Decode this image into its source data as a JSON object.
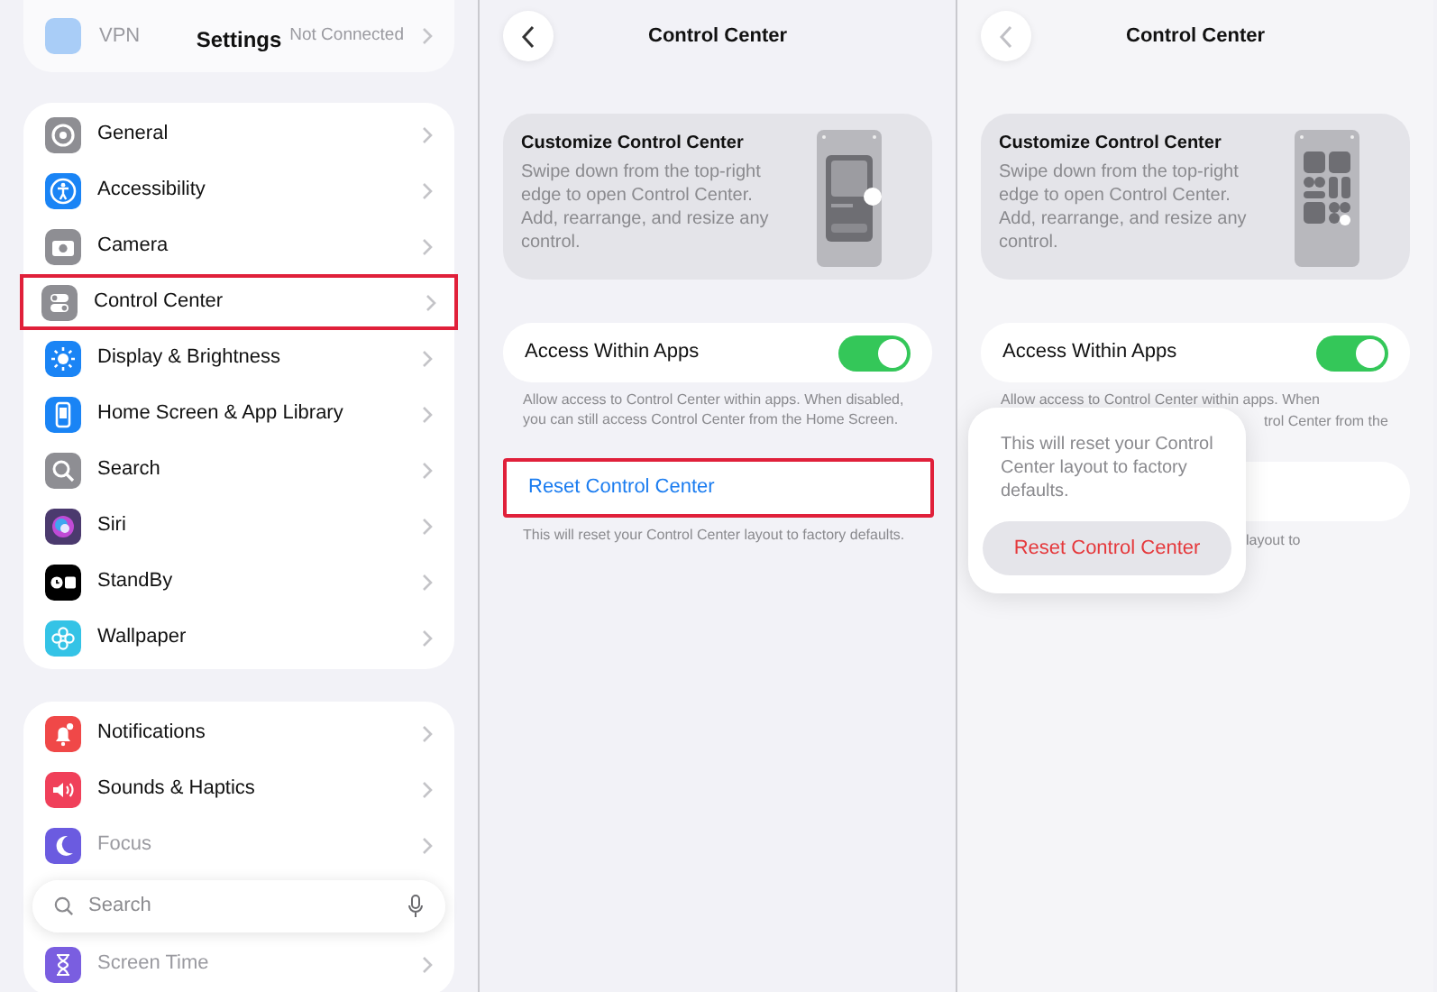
{
  "settings_screen": {
    "title": "Settings",
    "top_row": {
      "label": "VPN",
      "value": "Not Connected",
      "dimmed": true
    },
    "groups": [
      {
        "rows": [
          {
            "label": "General",
            "color": "#8e8e93",
            "highlighted": false,
            "dimmed": false
          },
          {
            "label": "Accessibility",
            "color": "#1a84f5",
            "highlighted": false,
            "dimmed": false
          },
          {
            "label": "Camera",
            "color": "#8e8e93",
            "highlighted": false,
            "dimmed": false
          },
          {
            "label": "Control Center",
            "color": "#8e8e93",
            "highlighted": true,
            "dimmed": false
          },
          {
            "label": "Display & Brightness",
            "color": "#1a84f5",
            "highlighted": false,
            "dimmed": false
          },
          {
            "label": "Home Screen & App Library",
            "color": "#1a84f5",
            "highlighted": false,
            "dimmed": false
          },
          {
            "label": "Search",
            "color": "#8e8e93",
            "highlighted": false,
            "dimmed": false
          },
          {
            "label": "Siri",
            "color": "#4b3a6e",
            "highlighted": false,
            "dimmed": false
          },
          {
            "label": "StandBy",
            "color": "#000000",
            "highlighted": false,
            "dimmed": false
          },
          {
            "label": "Wallpaper",
            "color": "#34c3e6",
            "highlighted": false,
            "dimmed": false
          }
        ]
      },
      {
        "rows": [
          {
            "label": "Notifications",
            "color": "#f04848",
            "highlighted": false,
            "dimmed": false
          },
          {
            "label": "Sounds & Haptics",
            "color": "#f0405a",
            "highlighted": false,
            "dimmed": false
          },
          {
            "label": "Focus",
            "color": "#6b5be0",
            "highlighted": false,
            "dimmed": true
          },
          {
            "label": "Screen Time",
            "color": "#7a5ee0",
            "highlighted": false,
            "dimmed": true
          }
        ]
      }
    ],
    "search": {
      "placeholder": "Search"
    }
  },
  "control_center_screen": {
    "back_disabled": false,
    "nav_title": "Control Center",
    "card": {
      "kind": "media",
      "title": "Customize Control Center",
      "description": "Swipe down from the top-right edge to open Control Center. Add, rearrange, and resize any control."
    },
    "toggle_row": {
      "label": "Access Within Apps",
      "on": true
    },
    "toggle_footer": "Allow access to Control Center within apps. When disabled, you can still access Control Center from the Home Screen.",
    "reset_row": {
      "label": "Reset Control Center",
      "highlighted": true
    },
    "reset_footer": "This will reset your Control Center layout to factory defaults."
  },
  "reset_confirm_screen": {
    "back_disabled": true,
    "nav_title": "Control Center",
    "card": {
      "kind": "tiles",
      "title": "Customize Control Center",
      "description": "Swipe down from the top-right edge to open Control Center. Add, rearrange, and resize any control."
    },
    "toggle_row": {
      "label": "Access Within Apps",
      "on": true
    },
    "toggle_footer_visible": "Allow access to Control Center within apps. When",
    "toggle_footer_fragment": "trol Center from the",
    "reset_footer_fragment": "layout to",
    "popover": {
      "message": "This will reset your Control Center layout to factory defaults.",
      "button": "Reset Control Center"
    }
  }
}
